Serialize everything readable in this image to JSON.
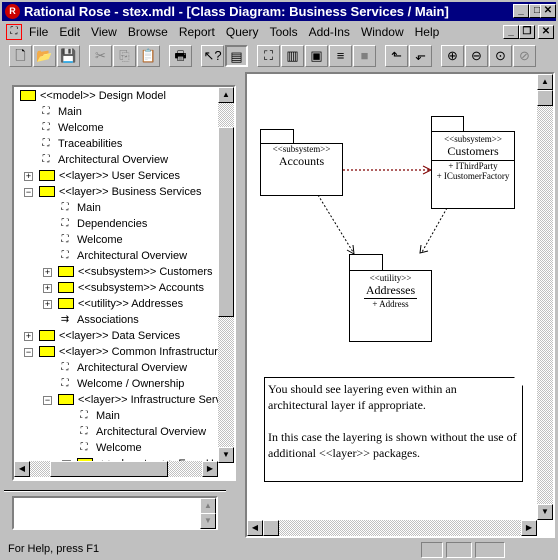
{
  "window": {
    "title": "Rational Rose - stex.mdl - [Class Diagram: Business Services / Main]",
    "minimize": "_",
    "maximize": "□",
    "close": "✕",
    "doc_restore": "❐"
  },
  "menu": [
    "File",
    "Edit",
    "View",
    "Browse",
    "Report",
    "Query",
    "Tools",
    "Add-Ins",
    "Window",
    "Help"
  ],
  "toolbar": [
    {
      "icon": "new-icon",
      "glyph": "🗋"
    },
    {
      "icon": "open-icon",
      "glyph": "📂"
    },
    {
      "icon": "save-icon",
      "glyph": "💾"
    },
    {
      "icon": "cut-icon",
      "glyph": "✂"
    },
    {
      "icon": "copy-icon",
      "glyph": "⎘"
    },
    {
      "icon": "paste-icon",
      "glyph": "📋"
    },
    {
      "icon": "print-icon",
      "glyph": "🖶"
    },
    {
      "icon": "context-help-icon",
      "glyph": "↖?"
    },
    {
      "icon": "documentation-window-icon",
      "glyph": "▤"
    },
    {
      "icon": "browse-class-diagram-icon",
      "glyph": "⛶"
    },
    {
      "icon": "browse-interaction-diagram-icon",
      "glyph": "▥"
    },
    {
      "icon": "browse-component-diagram-icon",
      "glyph": "▣"
    },
    {
      "icon": "browse-state-diagram-icon",
      "glyph": "≡"
    },
    {
      "icon": "browse-deployment-diagram-icon",
      "glyph": "■"
    },
    {
      "icon": "browse-parent-icon",
      "glyph": "⬑"
    },
    {
      "icon": "browse-previous-icon",
      "glyph": "⬐"
    },
    {
      "icon": "zoom-in-icon",
      "glyph": "⊕"
    },
    {
      "icon": "zoom-out-icon",
      "glyph": "⊖"
    },
    {
      "icon": "fit-in-window-icon",
      "glyph": "⊙"
    },
    {
      "icon": "undo-fit-icon",
      "glyph": "⊘"
    }
  ],
  "tree": [
    {
      "label": "<<model>> Design Model",
      "type": "folder",
      "level": 0
    },
    {
      "label": "Main",
      "type": "diagram",
      "level": 1
    },
    {
      "label": "Welcome",
      "type": "diagram",
      "level": 1
    },
    {
      "label": "Traceabilities",
      "type": "diagram",
      "level": 1
    },
    {
      "label": "Architectural Overview",
      "type": "diagram",
      "level": 1
    },
    {
      "label": "<<layer>> User Services",
      "type": "folder",
      "level": 1,
      "toggle": "+"
    },
    {
      "label": "<<layer>> Business Services",
      "type": "folder",
      "level": 1,
      "toggle": "−"
    },
    {
      "label": "Main",
      "type": "diagram",
      "level": 2
    },
    {
      "label": "Dependencies",
      "type": "diagram",
      "level": 2
    },
    {
      "label": "Welcome",
      "type": "diagram",
      "level": 2
    },
    {
      "label": "Architectural Overview",
      "type": "diagram",
      "level": 2
    },
    {
      "label": "<<subsystem>> Customers",
      "type": "folder",
      "level": 2,
      "toggle": "+"
    },
    {
      "label": "<<subsystem>> Accounts",
      "type": "folder",
      "level": 2,
      "toggle": "+"
    },
    {
      "label": "<<utility>> Addresses",
      "type": "folder",
      "level": 2,
      "toggle": "+"
    },
    {
      "label": "Associations",
      "type": "assoc",
      "level": 2
    },
    {
      "label": "<<layer>> Data Services",
      "type": "folder",
      "level": 1,
      "toggle": "+"
    },
    {
      "label": "<<layer>> Common Infrastructure",
      "type": "folder",
      "level": 1,
      "toggle": "−"
    },
    {
      "label": "Architectural Overview",
      "type": "diagram",
      "level": 2
    },
    {
      "label": "Welcome / Ownership",
      "type": "diagram",
      "level": 2
    },
    {
      "label": "<<layer>> Infrastructure Services",
      "type": "folder",
      "level": 2,
      "toggle": "−"
    },
    {
      "label": "Main",
      "type": "diagram",
      "level": 3
    },
    {
      "label": "Architectural Overview",
      "type": "diagram",
      "level": 3
    },
    {
      "label": "Welcome",
      "type": "diagram",
      "level": 3
    },
    {
      "label": "<<subsystem>> Error Handling",
      "type": "folder",
      "level": 3,
      "toggle": "+"
    }
  ],
  "documentation": {
    "value": ""
  },
  "diagram": {
    "accounts": {
      "stereotype": "<<subsystem>>",
      "name": "Accounts"
    },
    "customers": {
      "stereotype": "<<subsystem>>",
      "name": "Customers",
      "ops": [
        "+ IThirdParty",
        "+ ICustomerFactory"
      ]
    },
    "addresses": {
      "stereotype": "<<utility>>",
      "name": "Addresses",
      "ops": [
        "+ Address"
      ]
    },
    "note": {
      "p1": "You should see layering even within an architectural layer if appropriate.",
      "p2": "In this case the layering is shown without the use of additional <<layer>> packages."
    },
    "dependency_color": "#800000"
  },
  "status": {
    "text": "For Help, press F1"
  }
}
